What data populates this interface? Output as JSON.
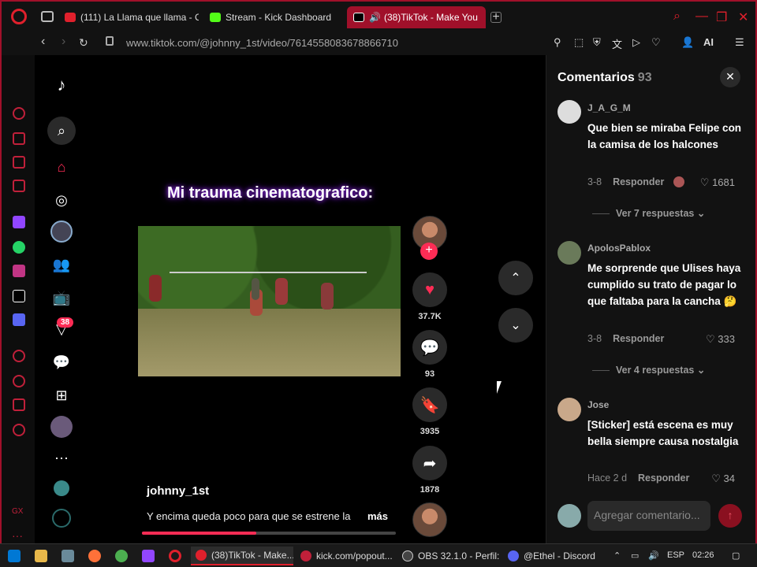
{
  "browser": {
    "tabs": [
      {
        "label": "(111) La Llama que llama - C",
        "color": "#e0202c"
      },
      {
        "label": "Stream - Kick Dashboard",
        "color": "#53fc18"
      },
      {
        "label": "(38)TikTok - Make You",
        "color": "#fff"
      }
    ],
    "url": "www.tiktok.com/@johnny_1st/video/7614558083678866710",
    "ai_label": "AI"
  },
  "sidebar": {
    "gx_label": "GX"
  },
  "tiktok_nav": {
    "inbox_badge": "38"
  },
  "video": {
    "overlay_caption": "Mi trauma cinematografico:",
    "author": "johnny_1st",
    "description": "Y encima queda poco para que se estrene la",
    "more_label": "más",
    "progress": 0.45,
    "likes": "37.7K",
    "comments": "93",
    "saves": "3935",
    "shares": "1878"
  },
  "comments_panel": {
    "title": "Comentarios",
    "count": "93",
    "items": [
      {
        "user": "J_A_G_M",
        "text": "Que bien se miraba Felipe con la camisa de los halcones",
        "date": "3-8",
        "reply_label": "Responder",
        "likes": "1681",
        "view_replies": "Ver 7 respuestas"
      },
      {
        "user": "ApolosPablox",
        "text": "Me sorprende que Ulises haya cumplido su trato de pagar lo que faltaba para la cancha 🤔",
        "date": "3-8",
        "reply_label": "Responder",
        "likes": "333",
        "view_replies": "Ver 4 respuestas"
      },
      {
        "user": "Jose",
        "text": "[Sticker] está escena es muy bella siempre causa nostalgia",
        "date": "Hace 2 d",
        "reply_label": "Responder",
        "likes": "34"
      }
    ],
    "input_placeholder": "Agregar comentario..."
  },
  "taskbar": {
    "items": [
      {
        "label": "(38)TikTok - Make...",
        "color": "#e0202c"
      },
      {
        "label": "kick.com/popout...",
        "color": "#c0203a"
      },
      {
        "label": "OBS 32.1.0 - Perfil:...",
        "color": "#444"
      },
      {
        "label": "@Ethel - Discord",
        "color": "#5865f2"
      }
    ],
    "lang": "ESP",
    "time": "02:26"
  }
}
